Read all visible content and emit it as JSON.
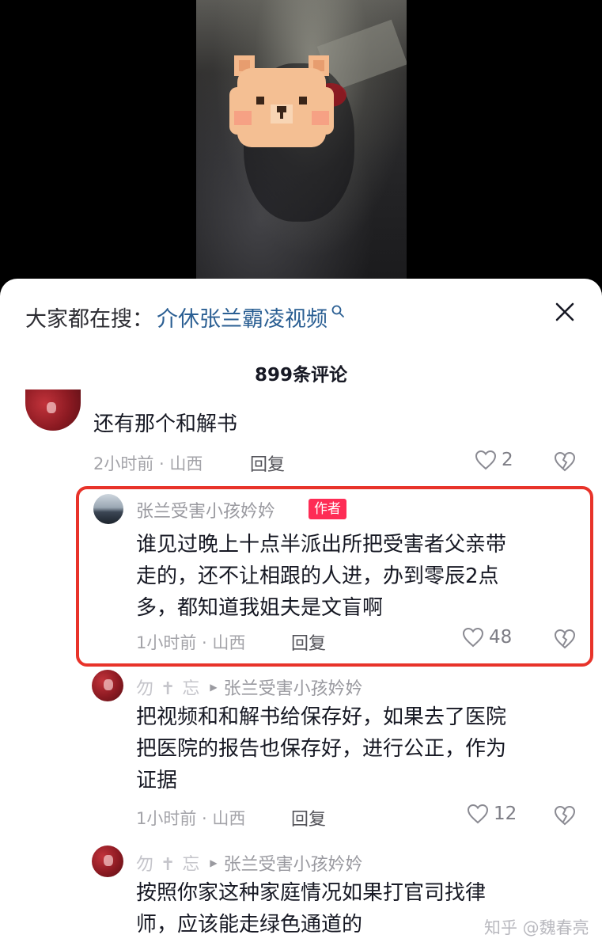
{
  "search_bar": {
    "prefix": "大家都在搜：",
    "term": "介休张兰霸凌视频"
  },
  "comments_header": {
    "count_label": "899条评论"
  },
  "comments": [
    {
      "text": "还有那个和解书",
      "time_location": "2小时前 · 山西",
      "reply_label": "回复",
      "likes": "2"
    },
    {
      "username": "张兰受害小孩妗妗",
      "badge": "作者",
      "text_lines": [
        "谁见过晚上十点半派出所把受害者父亲带",
        "走的，还不让相跟的人进，办到零辰2点",
        "多，都知道我姐夫是文盲啊"
      ],
      "time_location": "1小时前 · 山西",
      "reply_label": "回复",
      "likes": "48"
    },
    {
      "username": "勿 ✝ 忘",
      "reply_to": "张兰受害小孩妗妗",
      "text_lines": [
        "把视频和和解书给保存好，如果去了医院",
        "把医院的报告也保存好，进行公正，作为",
        "证据"
      ],
      "time_location": "1小时前 · 山西",
      "reply_label": "回复",
      "likes": "12"
    },
    {
      "username": "勿 ✝ 忘",
      "reply_to": "张兰受害小孩妗妗",
      "text_lines": [
        "按照你家这种家庭情况如果打官司找律",
        "师，应该能走绿色通道的"
      ]
    }
  ],
  "watermark": "知乎 @魏春亮",
  "colors": {
    "highlight": "#e8332a",
    "badge": "#fe2c55",
    "search_term": "#2b5f93"
  },
  "icons": [
    "search-icon",
    "close-icon",
    "heart-icon",
    "dislike-icon"
  ]
}
